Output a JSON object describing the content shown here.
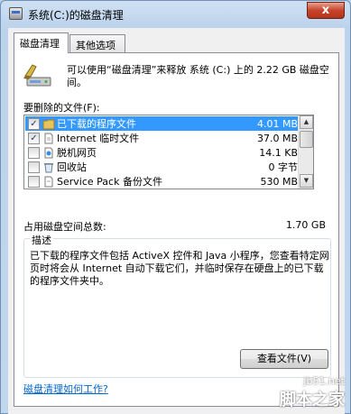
{
  "window": {
    "title": "系统(C:)的磁盘清理",
    "close_label": "x"
  },
  "tabs": [
    {
      "label": "磁盘清理"
    },
    {
      "label": "其他选项"
    }
  ],
  "intro": "可以使用“磁盘清理”来释放 系统 (C:) 上的 2.22 GB 磁盘空间。",
  "files_label": "要删除的文件(F):",
  "files": [
    {
      "name": "已下载的程序文件",
      "size": "4.01 MB",
      "checked": true,
      "selected": true
    },
    {
      "name": "Internet 临时文件",
      "size": "37.0 MB",
      "checked": true,
      "selected": false
    },
    {
      "name": "脱机网页",
      "size": "14.1 KB",
      "checked": false,
      "selected": false
    },
    {
      "name": "回收站",
      "size": "0 字节",
      "checked": false,
      "selected": false
    },
    {
      "name": "Service Pack 备份文件",
      "size": "530 MB",
      "checked": false,
      "selected": false
    }
  ],
  "checkmark": "✓",
  "scroll": {
    "up": "▲",
    "down": "▼"
  },
  "total": {
    "label": "占用磁盘空间总数:",
    "value": "1.70 GB"
  },
  "description": {
    "legend": "描述",
    "text": "已下载的程序文件包括 ActiveX 控件和 Java 小程序，您查看特定网页时将会从 Internet 自动下载它们，并临时保存在硬盘上的已下载的程序文件夹中。",
    "button": "查看文件(V)"
  },
  "help_link": "磁盘清理如何工作?",
  "watermark": {
    "url": "jb51.net",
    "name": "脚本之家"
  },
  "colors": {
    "selection": "#3399ff",
    "link": "#0066cc",
    "close": "#c7432b"
  }
}
